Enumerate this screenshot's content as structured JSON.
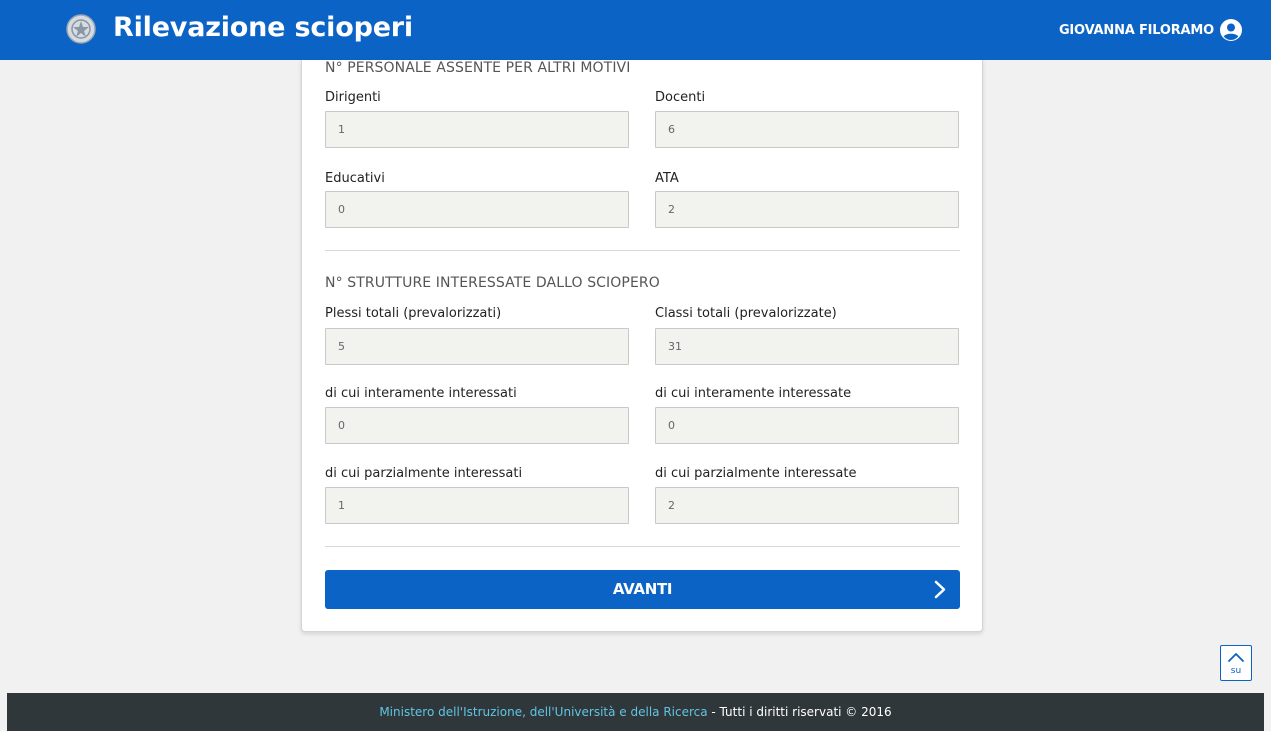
{
  "header": {
    "title": "Rilevazione scioperi",
    "user_name": "GIOVANNA FILORAMO",
    "logo_icon": "emblem-icon",
    "user_icon": "user-circle-icon",
    "color": "#0b63c5"
  },
  "section_absent": {
    "title": "N° PERSONALE ASSENTE PER ALTRI MOTIVI",
    "fields": [
      {
        "label": "Dirigenti",
        "value": "1"
      },
      {
        "label": "Docenti",
        "value": "6"
      },
      {
        "label": "Educativi",
        "value": "0"
      },
      {
        "label": "ATA",
        "value": "2"
      }
    ]
  },
  "section_structures": {
    "title": "N° STRUTTURE INTERESSATE DALLO SCIOPERO",
    "fields": [
      {
        "label": "Plessi totali (prevalorizzati)",
        "value": "5"
      },
      {
        "label": "Classi totali (prevalorizzate)",
        "value": "31"
      },
      {
        "label": "di cui interamente interessati",
        "value": "0"
      },
      {
        "label": "di cui interamente interessate",
        "value": "0"
      },
      {
        "label": "di cui parzialmente interessati",
        "value": "1"
      },
      {
        "label": "di cui parzialmente interessate",
        "value": "2"
      }
    ]
  },
  "actions": {
    "next_label": "AVANTI",
    "next_icon": "chevron-right-icon"
  },
  "back_to_top": {
    "label": "su",
    "icon": "chevron-up-icon"
  },
  "footer": {
    "link_text": "Ministero dell'Istruzione, dell'Università e della Ricerca",
    "rest_text": " - Tutti i diritti riservati © 2016",
    "link_color": "#5ec6e4",
    "bg_color": "#30373b"
  }
}
